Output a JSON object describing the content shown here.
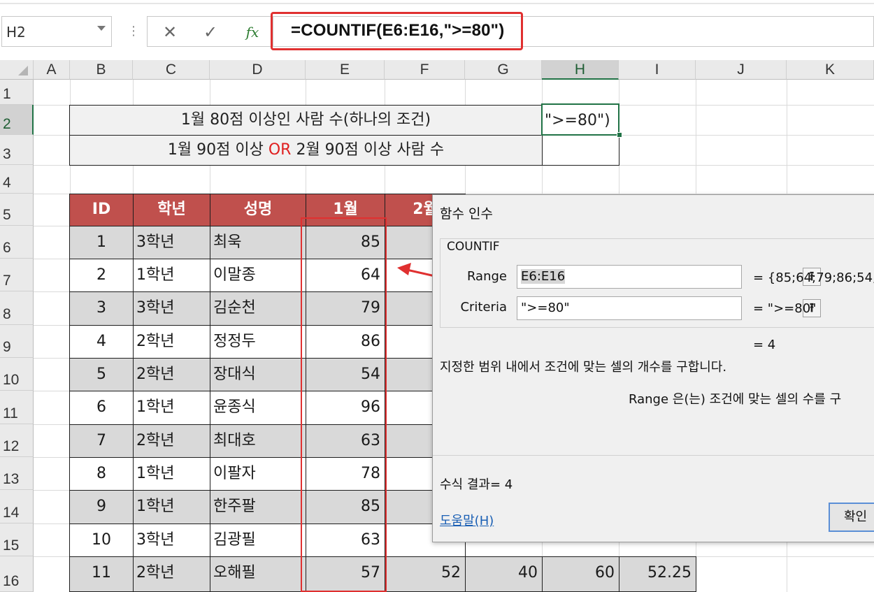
{
  "formula_bar": {
    "name_box": "H2",
    "cancel_icon": "✕",
    "enter_icon": "✓",
    "fx_label": "fx",
    "formula": "=COUNTIF(E6:E16,\">=80\")"
  },
  "columns": [
    "A",
    "B",
    "C",
    "D",
    "E",
    "F",
    "G",
    "H",
    "I",
    "J",
    "K"
  ],
  "rows": [
    "1",
    "2",
    "3",
    "4",
    "5",
    "6",
    "7",
    "8",
    "9",
    "10",
    "11",
    "12",
    "13",
    "14",
    "15",
    "16"
  ],
  "sheet": {
    "title1": "1월 80점 이상인 사람 수(하나의 조건)",
    "title2_a": "1월 90점 이상 ",
    "title2_or": "OR",
    "title2_b": " 2월 90점 이상 사람 수",
    "h2_value": "\">=80\")",
    "headers": [
      "ID",
      "학년",
      "성명",
      "1월",
      "2월"
    ],
    "table": [
      {
        "id": "1",
        "grade": "3학년",
        "name": "최욱",
        "jan": "85"
      },
      {
        "id": "2",
        "grade": "1학년",
        "name": "이말종",
        "jan": "64"
      },
      {
        "id": "3",
        "grade": "3학년",
        "name": "김순천",
        "jan": "79"
      },
      {
        "id": "4",
        "grade": "2학년",
        "name": "정정두",
        "jan": "86"
      },
      {
        "id": "5",
        "grade": "2학년",
        "name": "장대식",
        "jan": "54"
      },
      {
        "id": "6",
        "grade": "1학년",
        "name": "윤종식",
        "jan": "96"
      },
      {
        "id": "7",
        "grade": "2학년",
        "name": "최대호",
        "jan": "63"
      },
      {
        "id": "8",
        "grade": "1학년",
        "name": "이팔자",
        "jan": "78"
      },
      {
        "id": "9",
        "grade": "1학년",
        "name": "한주팔",
        "jan": "85"
      },
      {
        "id": "10",
        "grade": "3학년",
        "name": "김광필",
        "jan": "63"
      },
      {
        "id": "11",
        "grade": "2학년",
        "name": "오해필",
        "jan": "57",
        "feb": "52",
        "g": "40",
        "h": "60",
        "i": "52.25"
      }
    ]
  },
  "dialog": {
    "title": "함수 인수",
    "function_name": "COUNTIF",
    "arg1_label": "Range",
    "arg1_value": "E6:E16",
    "arg1_result": "=   {85;64;79;86;54;",
    "arg2_label": "Criteria",
    "arg2_value": "\">=80\"",
    "arg2_result": "=   \">=80\"",
    "result_line": "=   4",
    "description": "지정한 범위 내에서 조건에 맞는 셀의 개수를 구합니다.",
    "arg_description": "Range   은(는) 조건에 맞는 셀의 수를 구",
    "formula_result": "수식 결과=   4",
    "help_link": "도움말(H)",
    "ok_button": "확인",
    "collapse_icon": "⭱"
  },
  "colors": {
    "header_red": "#c0504d",
    "highlight_red": "#e03030",
    "excel_green": "#217346",
    "or_red": "#e02020"
  }
}
